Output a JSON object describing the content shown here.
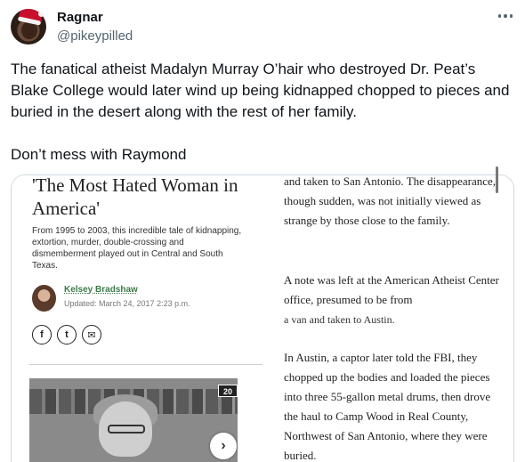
{
  "tweet": {
    "display_name": "Ragnar",
    "handle": "@pikeypilled",
    "text": "The fanatical atheist Madalyn Murray O’hair who destroyed Dr. Peat’s Blake College would later wind up being kidnapped chopped to pieces and buried in the desert along with the rest of her family.\n\nDon’t mess with Raymond",
    "more_icon": "more-horizontal-icon"
  },
  "image_left": {
    "title": "'The Most Hated Woman in America'",
    "summary": "From 1995 to 2003, this incredible tale of kidnapping, extortion, murder, double-crossing and dismemberment played out in Central and South Texas.",
    "author": "Kelsey Bradshaw",
    "updated": "Updated: March 24, 2017 2:23 p.m.",
    "share_icons": [
      "f",
      "t",
      "✉"
    ],
    "photo_count": "20",
    "next_icon": "chevron-right-icon"
  },
  "image_right": {
    "para1": "and taken to San Antonio. The disappearance, though sudden, was not initially viewed as strange by those close to the family.",
    "para2": "A note was left at the American Atheist Center office, presumed to be from",
    "para3": "a van and taken to Austin.",
    "para4": "In Austin, a captor later told the FBI, they chopped up the bodies and loaded the pieces into three 55-gallon metal drums, then drove the haul to Camp Wood in Real County, Northwest of San Antonio, where they were buried."
  },
  "colors": {
    "text": "#0f1419",
    "secondary": "#536471",
    "border": "#cfd9de",
    "author_link": "#3d7a4a"
  }
}
